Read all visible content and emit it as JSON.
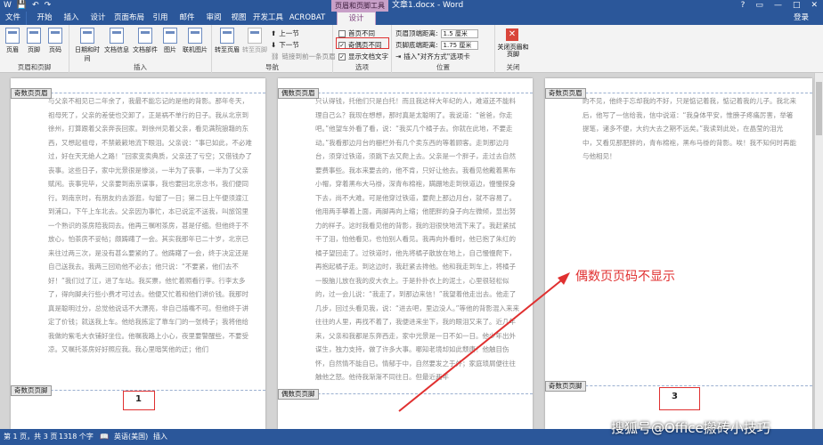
{
  "window": {
    "context_tab": "页眉和页脚工具",
    "title": "文章1.docx - Word",
    "controls": [
      "?",
      "▭",
      "—",
      "□",
      "✕"
    ]
  },
  "tabs": [
    "文件",
    "开始",
    "插入",
    "设计",
    "页面布局",
    "引用",
    "邮件",
    "审阅",
    "视图",
    "开发工具",
    "ACROBAT",
    "设计"
  ],
  "login": "登录",
  "ribbon": {
    "group1": {
      "label": "页眉和页脚",
      "buttons": [
        "页眉",
        "页脚",
        "页码"
      ]
    },
    "group2": {
      "label": "插入",
      "buttons": [
        "日期和时间",
        "文档信息",
        "文档部件",
        "图片",
        "联机图片"
      ]
    },
    "group3": {
      "label": "导航",
      "buttons": [
        "转至页眉",
        "转至页脚"
      ],
      "small": [
        "上一节",
        "下一节",
        "链接到前一条页眉"
      ]
    },
    "group4": {
      "label": "选项",
      "options": [
        "首页不同",
        "奇偶页不同",
        "显示文档文字"
      ]
    },
    "group5": {
      "label": "位置",
      "header_label": "页眉顶端距离:",
      "header_value": "1.5 厘米",
      "footer_label": "页脚底端距离:",
      "footer_value": "1.75 厘米",
      "insert_tab": "插入\"对齐方式\"选项卡"
    },
    "group6": {
      "label": "关闭",
      "button": "关闭页眉和页脚"
    }
  },
  "pages": [
    {
      "header_tag": "奇数页页眉",
      "footer_tag": "奇数页页脚",
      "number": "1",
      "text": "与父亲不相见已二年余了，我最不能忘记的是他的背影。那年冬天，祖母死了，父亲的差使也交卸了，正是祸不单行的日子。我从北京到徐州，打算跟着父亲奔丧回家。到徐州见着父亲，看见满院狼藉的东西，又想起祖母，不禁簌簌地流下眼泪。父亲说：“事已如此，不必难过，好在天无绝人之路！”回家变卖典质，父亲还了亏空；又借钱办了丧事。这些日子，家中光景很是惨淡，一半为了丧事，一半为了父亲赋闲。丧事完毕，父亲要到南京谋事，我也要回北京念书，我们便同行。到南京时，有朋友约去游逛，勾留了一日；第二日上午便须渡江到浦口，下午上车北去。父亲因为事忙，本已说定不送我，叫旅馆里一个熟识的茶房陪我同去。他再三嘱咐茶房，甚是仔细。但他终于不放心，怕茶房不妥帖；颇踌躇了一会。其实我那年已二十岁，北京已来往过两三次，是没有甚么要紧的了。他踌躇了一会，终于决定还是自己送我去。我两三回劝他不必去；他只说：“不要紧，他们去不好！”我们过了江，进了车站。我买票，他忙着照看行李。行李太多了，得向脚夫行些小费才可过去。他便又忙着和他们讲价钱。我那时真是聪明过分，总觉他说话不大漂亮，非自己插嘴不可。但他终于讲定了价钱；就送我上车。他给我拣定了靠车门的一张椅子；我将他给我做的紫毛大衣铺好坐位。他嘱我路上小心，夜里要警醒些，不要受凉。又嘱托茶房好好照应我。我心里暗笑他的迂；他们"
    },
    {
      "header_tag": "偶数页页眉",
      "footer_tag": "偶数页页脚",
      "number": "",
      "text": "只认得钱，托他们只是白托！而且我这样大年纪的人，难道还不能料理自己么？我现在想想，那时真是太聪明了。我说道：“爸爸，你走吧。”他望车外看了看，说：“我买几个橘子去。你就在此地，不要走动。”我看那边月台的栅栏外有几个卖东西的等着顾客。走到那边月台，须穿过铁道，须跳下去又爬上去。父亲是一个胖子，走过去自然要费事些。我本来要去的，他不肯，只好让他去。我看见他戴着黑布小帽，穿着黑布大马褂，深青布棉袍，蹒跚地走到铁道边，慢慢探身下去，尚不大难。可是他穿过铁道，要爬上那边月台，就不容易了。他用两手攀着上面，两脚再向上缩；他肥胖的身子向左微倾，显出努力的样子。这时我看见他的背影，我的泪很快地流下来了。我赶紧拭干了泪，怕他看见，也怕别人看见。我再向外看时，他已抱了朱红的橘子望回走了。过铁道时，他先将橘子散放在地上，自己慢慢爬下，再抱起橘子走。到这边时，我赶紧去搀他。他和我走到车上，将橘子一股脑儿放在我的皮大衣上。于是扑扑衣上的泥土，心里很轻松似的，过一会儿说：“我走了，到那边来信！”我望着他走出去。他走了几步，回过头看见我，说：“进去吧，里边没人。”等他的背影混入来来往往的人里，再找不着了，我便进来坐下，我的眼泪又来了。近几年来，父亲和我都是东奔西走，家中光景是一日不如一日。他少年出外谋生，独力支持，做了许多大事。哪知老境却如此颓唐！他触目伤怀，自然情不能自已。情郁于中，自然要发之于外；家庭琐屑便往往触他之怒。他待我渐渐不同往日。但最近两年"
    },
    {
      "header_tag": "奇数页页眉",
      "footer_tag": "奇数页页脚",
      "number": "3",
      "text": "的不见，他终于忘却我的不好，只是惦记着我，惦记着我的儿子。我北来后，他写了一信给我，信中说道：“我身体平安，惟膀子疼痛厉害，举箸提笔，诸多不便，大约大去之期不远矣。”我读到此处，在晶莹的泪光中，又看见那肥胖的，青布棉袍，黑布马褂的背影。唉！我不知何时再能与他相见！"
    }
  ],
  "annotation": "偶数页页码不显示",
  "status": {
    "page": "第 1 页，共 3 页",
    "words": "1318 个字",
    "lang": "英语(美国)",
    "mode": "插入"
  },
  "watermark": "搜狐号@Office搬砖小技巧"
}
